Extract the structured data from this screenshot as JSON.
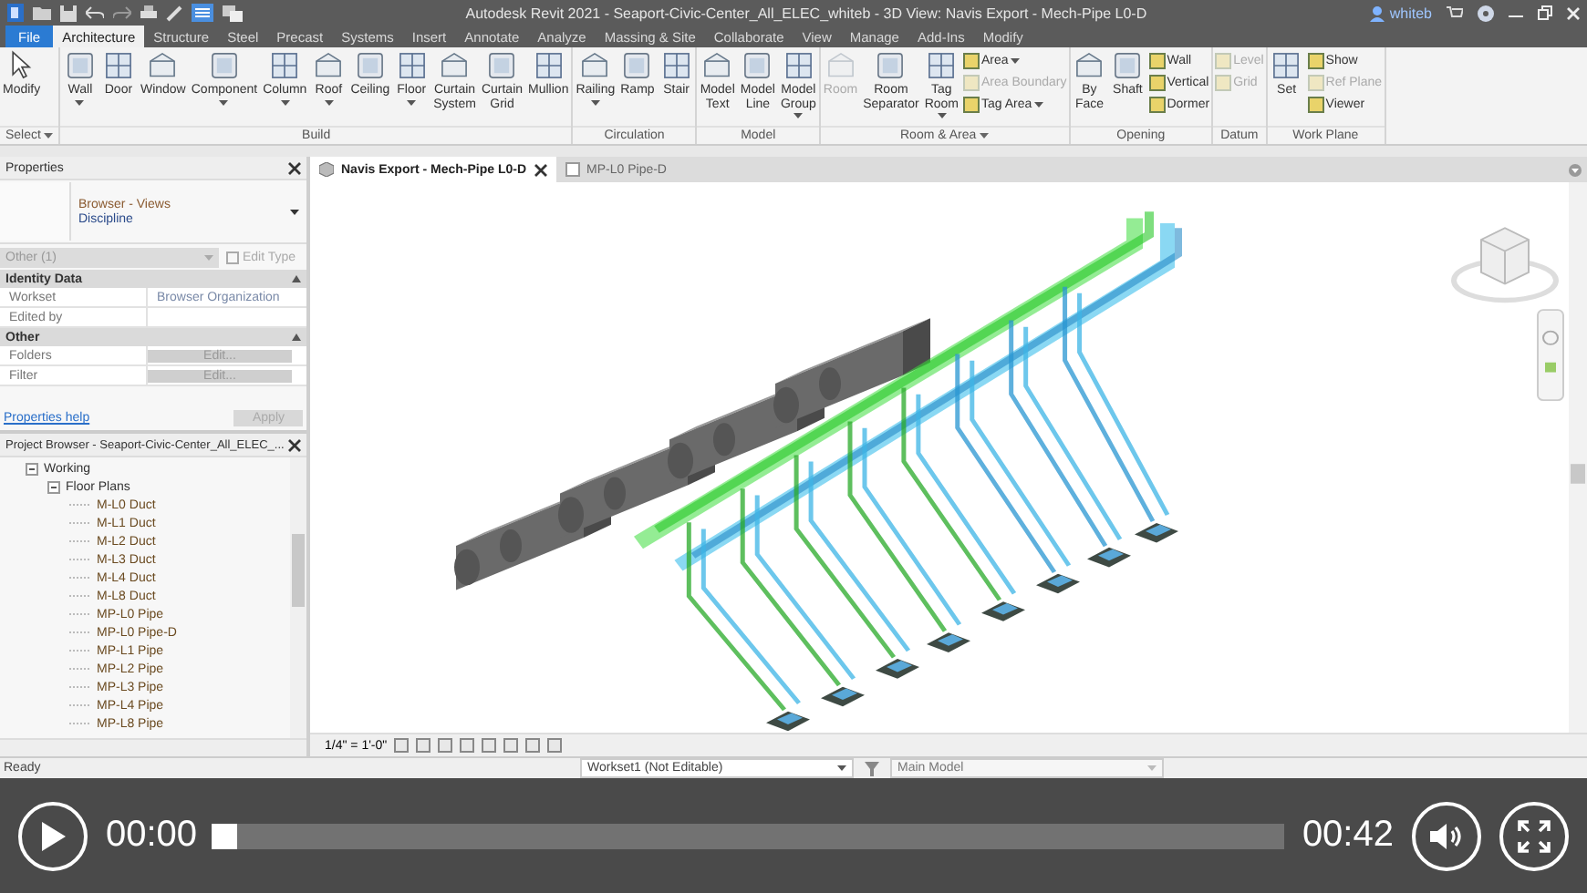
{
  "window": {
    "title": "Autodesk Revit 2021 - Seaport-Civic-Center_All_ELEC_whiteb - 3D View: Navis Export - Mech-Pipe L0-D",
    "user": "whiteb"
  },
  "ribbon": {
    "tabs": [
      {
        "label": "File",
        "kind": "application",
        "selected": false
      },
      {
        "label": "Architecture",
        "kind": "tab",
        "selected": true
      },
      {
        "label": "Structure",
        "kind": "tab",
        "selected": false
      },
      {
        "label": "Steel",
        "kind": "tab",
        "selected": false
      },
      {
        "label": "Precast",
        "kind": "tab",
        "selected": false
      },
      {
        "label": "Systems",
        "kind": "tab",
        "selected": false
      },
      {
        "label": "Insert",
        "kind": "tab",
        "selected": false
      },
      {
        "label": "Annotate",
        "kind": "tab",
        "selected": false
      },
      {
        "label": "Analyze",
        "kind": "tab",
        "selected": false
      },
      {
        "label": "Massing & Site",
        "kind": "tab",
        "selected": false
      },
      {
        "label": "Collaborate",
        "kind": "tab",
        "selected": false
      },
      {
        "label": "View",
        "kind": "tab",
        "selected": false
      },
      {
        "label": "Manage",
        "kind": "tab",
        "selected": false
      },
      {
        "label": "Add-Ins",
        "kind": "tab",
        "selected": false
      },
      {
        "label": "Modify",
        "kind": "tab",
        "selected": false
      }
    ],
    "panels": [
      {
        "label": "Select",
        "dropdown": true,
        "items": [
          {
            "label": "Modify",
            "kind": "large",
            "dropdown": false,
            "disabled": false
          }
        ]
      },
      {
        "label": "Build",
        "dropdown": false,
        "items": [
          {
            "label": "Wall",
            "kind": "large",
            "dropdown": true,
            "disabled": false
          },
          {
            "label": "Door",
            "kind": "large",
            "dropdown": false,
            "disabled": false
          },
          {
            "label": "Window",
            "kind": "large",
            "dropdown": false,
            "disabled": false
          },
          {
            "label": "Component",
            "kind": "large",
            "dropdown": true,
            "disabled": false
          },
          {
            "label": "Column",
            "kind": "large",
            "dropdown": true,
            "disabled": false
          },
          {
            "label": "Roof",
            "kind": "large",
            "dropdown": true,
            "disabled": false
          },
          {
            "label": "Ceiling",
            "kind": "large",
            "dropdown": false,
            "disabled": false
          },
          {
            "label": "Floor",
            "kind": "large",
            "dropdown": true,
            "disabled": false
          },
          {
            "label": "Curtain System",
            "kind": "large",
            "dropdown": false,
            "disabled": false
          },
          {
            "label": "Curtain Grid",
            "kind": "large",
            "dropdown": false,
            "disabled": false
          },
          {
            "label": "Mullion",
            "kind": "large",
            "dropdown": false,
            "disabled": false
          }
        ]
      },
      {
        "label": "Circulation",
        "dropdown": false,
        "items": [
          {
            "label": "Railing",
            "kind": "large",
            "dropdown": true,
            "disabled": false
          },
          {
            "label": "Ramp",
            "kind": "large",
            "dropdown": false,
            "disabled": false
          },
          {
            "label": "Stair",
            "kind": "large",
            "dropdown": false,
            "disabled": false
          }
        ]
      },
      {
        "label": "Model",
        "dropdown": false,
        "items": [
          {
            "label": "Model Text",
            "kind": "large",
            "dropdown": false,
            "disabled": false
          },
          {
            "label": "Model Line",
            "kind": "large",
            "dropdown": false,
            "disabled": false
          },
          {
            "label": "Model Group",
            "kind": "large",
            "dropdown": true,
            "disabled": false
          }
        ]
      },
      {
        "label": "Room & Area",
        "dropdown": true,
        "items": [
          {
            "label": "Room",
            "kind": "large",
            "dropdown": false,
            "disabled": true
          },
          {
            "label": "Room Separator",
            "kind": "large",
            "dropdown": false,
            "disabled": false
          },
          {
            "label": "Tag Room",
            "kind": "large",
            "dropdown": true,
            "disabled": false
          },
          {
            "label": "Area",
            "kind": "small",
            "dropdown": true,
            "disabled": false
          },
          {
            "label": "Area Boundary",
            "kind": "small",
            "dropdown": false,
            "disabled": true
          },
          {
            "label": "Tag Area",
            "kind": "small",
            "dropdown": true,
            "disabled": false
          }
        ]
      },
      {
        "label": "Opening",
        "dropdown": false,
        "items": [
          {
            "label": "By Face",
            "kind": "large",
            "dropdown": false,
            "disabled": false
          },
          {
            "label": "Shaft",
            "kind": "large",
            "dropdown": false,
            "disabled": false
          },
          {
            "label": "Wall",
            "kind": "small",
            "dropdown": false,
            "disabled": false
          },
          {
            "label": "Vertical",
            "kind": "small",
            "dropdown": false,
            "disabled": false
          },
          {
            "label": "Dormer",
            "kind": "small",
            "dropdown": false,
            "disabled": false
          }
        ]
      },
      {
        "label": "Datum",
        "dropdown": false,
        "items": [
          {
            "label": "Level",
            "kind": "small",
            "dropdown": false,
            "disabled": true
          },
          {
            "label": "Grid",
            "kind": "small",
            "dropdown": false,
            "disabled": true
          }
        ]
      },
      {
        "label": "Work Plane",
        "dropdown": false,
        "items": [
          {
            "label": "Set",
            "kind": "large",
            "dropdown": false,
            "disabled": false
          },
          {
            "label": "Show",
            "kind": "small",
            "dropdown": false,
            "disabled": false
          },
          {
            "label": "Ref Plane",
            "kind": "small",
            "dropdown": false,
            "disabled": true
          },
          {
            "label": "Viewer",
            "kind": "small",
            "dropdown": false,
            "disabled": false
          }
        ]
      }
    ]
  },
  "properties": {
    "title": "Properties",
    "type_family": "Browser - Views",
    "type_name": "Discipline",
    "instance_filter": "Other (1)",
    "edit_type": "Edit Type",
    "groups": [
      {
        "label": "Identity Data",
        "rows": [
          {
            "name": "Workset",
            "value": "Browser Organization",
            "kind": "text"
          },
          {
            "name": "Edited by",
            "kind": "text"
          }
        ]
      },
      {
        "label": "Other",
        "rows": [
          {
            "name": "Folders",
            "value": "Edit...",
            "kind": "button"
          },
          {
            "name": "Filter",
            "value": "Edit...",
            "kind": "button"
          }
        ]
      }
    ],
    "help_link": "Properties help",
    "apply": "Apply"
  },
  "project_browser": {
    "title": "Project Browser - Seaport-Civic-Center_All_ELEC_...",
    "tree": [
      {
        "label": "Working",
        "expanded": true,
        "selected": false,
        "children": [
          {
            "label": "Floor Plans",
            "expanded": true,
            "selected": false,
            "children": [
              {
                "label": "M-L0 Duct",
                "selected": false
              },
              {
                "label": "M-L1 Duct",
                "selected": false
              },
              {
                "label": "M-L2 Duct",
                "selected": false
              },
              {
                "label": "M-L3 Duct",
                "selected": false
              },
              {
                "label": "M-L4 Duct",
                "selected": false
              },
              {
                "label": "M-L8 Duct",
                "selected": false
              },
              {
                "label": "MP-L0 Pipe",
                "selected": false
              },
              {
                "label": "MP-L0 Pipe-D",
                "selected": false
              },
              {
                "label": "MP-L1 Pipe",
                "selected": false
              },
              {
                "label": "MP-L2 Pipe",
                "selected": false
              },
              {
                "label": "MP-L3 Pipe",
                "selected": false
              },
              {
                "label": "MP-L4 Pipe",
                "selected": false
              },
              {
                "label": "MP-L8 Pipe",
                "selected": false
              }
            ]
          }
        ]
      }
    ]
  },
  "view_tabs": [
    {
      "label": "Navis Export - Mech-Pipe L0-D",
      "selected": true
    },
    {
      "label": "MP-L0 Pipe-D",
      "selected": false
    }
  ],
  "view_control_bar": {
    "scale": "1/4\" = 1'-0\""
  },
  "status_bar": {
    "status": "Ready",
    "workset": "Workset1 (Not Editable)",
    "design_option": "Main Model"
  },
  "video_player": {
    "elapsed": "00:00",
    "duration": "00:42",
    "level": 0
  }
}
